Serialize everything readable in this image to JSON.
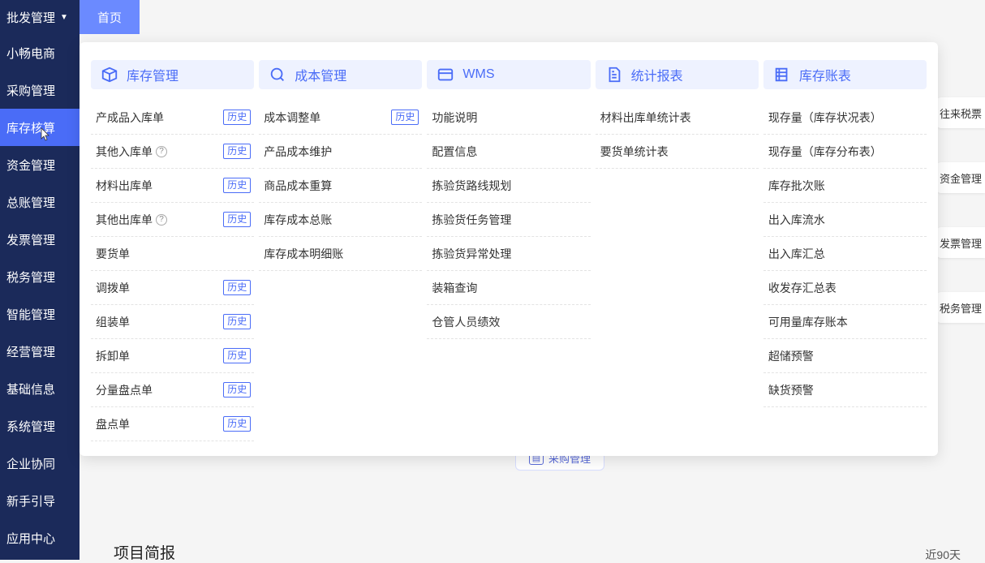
{
  "sidebar": {
    "top": {
      "label": "批发管理"
    },
    "items": [
      {
        "label": "小畅电商"
      },
      {
        "label": "采购管理"
      },
      {
        "label": "库存核算",
        "active": true
      },
      {
        "label": "资金管理"
      },
      {
        "label": "总账管理"
      },
      {
        "label": "发票管理"
      },
      {
        "label": "税务管理"
      },
      {
        "label": "智能管理"
      },
      {
        "label": "经营管理"
      },
      {
        "label": "基础信息"
      },
      {
        "label": "系统管理"
      },
      {
        "label": "企业协同"
      },
      {
        "label": "新手引导"
      },
      {
        "label": "应用中心"
      }
    ]
  },
  "topTab": {
    "label": "首页"
  },
  "rightPills": [
    "往来税票",
    "资金管理",
    "发票管理",
    "税务管理"
  ],
  "historyBadge": "历史",
  "megaMenu": {
    "columns": [
      {
        "title": "库存管理",
        "icon": "cube-icon",
        "items": [
          {
            "label": "产成品入库单",
            "history": true
          },
          {
            "label": "其他入库单",
            "help": true,
            "history": true
          },
          {
            "label": "材料出库单",
            "history": true
          },
          {
            "label": "其他出库单",
            "help": true,
            "history": true
          },
          {
            "label": "要货单"
          },
          {
            "label": "调拨单",
            "history": true
          },
          {
            "label": "组装单",
            "history": true
          },
          {
            "label": "拆卸单",
            "history": true
          },
          {
            "label": "分量盘点单",
            "history": true
          },
          {
            "label": "盘点单",
            "history": true
          }
        ]
      },
      {
        "title": "成本管理",
        "icon": "cost-icon",
        "items": [
          {
            "label": "成本调整单",
            "history": true
          },
          {
            "label": "产品成本维护"
          },
          {
            "label": "商品成本重算"
          },
          {
            "label": "库存成本总账"
          },
          {
            "label": "库存成本明细账"
          }
        ]
      },
      {
        "title": "WMS",
        "icon": "wms-icon",
        "items": [
          {
            "label": "功能说明"
          },
          {
            "label": "配置信息"
          },
          {
            "label": "拣验货路线规划"
          },
          {
            "label": "拣验货任务管理"
          },
          {
            "label": "拣验货异常处理"
          },
          {
            "label": "装箱查询"
          },
          {
            "label": "仓管人员绩效"
          }
        ]
      },
      {
        "title": "统计报表",
        "icon": "report-icon",
        "items": [
          {
            "label": "材料出库单统计表"
          },
          {
            "label": "要货单统计表"
          }
        ]
      },
      {
        "title": "库存账表",
        "icon": "ledger-icon",
        "items": [
          {
            "label": "现存量（库存状况表）"
          },
          {
            "label": "现存量（库存分布表）"
          },
          {
            "label": "库存批次账"
          },
          {
            "label": "出入库流水"
          },
          {
            "label": "出入库汇总"
          },
          {
            "label": "收发存汇总表"
          },
          {
            "label": "可用量库存账本"
          },
          {
            "label": "超储预警"
          },
          {
            "label": "缺货预警"
          }
        ]
      }
    ]
  },
  "bgCard": {
    "label": "采购管理"
  },
  "bottom": {
    "title": "项目简报",
    "filter": "近90天"
  }
}
